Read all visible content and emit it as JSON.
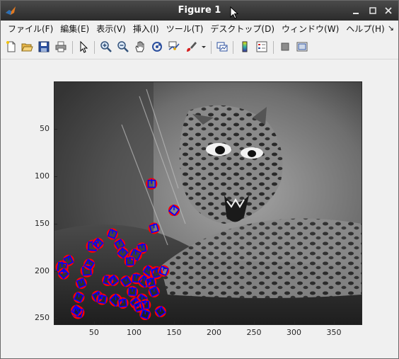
{
  "window": {
    "title": "Figure 1"
  },
  "menu": [
    "ファイル(F)",
    "編集(E)",
    "表示(V)",
    "挿入(I)",
    "ツール(T)",
    "デスクトップ(D)",
    "ウィンドウ(W)",
    "ヘルプ(H)"
  ],
  "menu_overflow": "↘",
  "toolbar_icons": [
    "new-figure-icon",
    "open-file-icon",
    "save-icon",
    "print-icon",
    "pointer-arrow-icon",
    "zoom-in-icon",
    "zoom-out-icon",
    "pan-hand-icon",
    "rotate-3d-icon",
    "data-cursor-icon",
    "brush-icon",
    "dropdown-arrow-icon",
    "link-plot-icon",
    "colorbar-icon",
    "legend-icon",
    "hide-plot-tools-icon",
    "show-plot-tools-icon"
  ],
  "image_description_free": "",
  "axes": {
    "x_ticks": [
      "50",
      "100",
      "150",
      "200",
      "250",
      "300",
      "350"
    ],
    "y_ticks": [
      "50",
      "100",
      "150",
      "200",
      "250"
    ]
  },
  "chart_data": {
    "type": "scatter",
    "title": "",
    "xlabel": "",
    "ylabel": "",
    "xlim": [
      0.5,
      384.5
    ],
    "ylim": [
      256.5,
      0.5
    ],
    "y_reversed": true,
    "series": [
      {
        "marker": "circle",
        "colors": {
          "circle": "#ff0000",
          "line": "#0000ff"
        },
        "x": [
          122,
          150,
          125,
          73,
          82,
          48,
          55,
          110,
          102,
          18,
          10,
          12,
          41,
          44,
          34,
          67,
          74,
          95,
          118,
          128,
          137,
          90,
          103,
          113,
          121,
          31,
          54,
          60,
          77,
          86,
          110,
          125,
          30,
          102,
          114,
          28,
          106,
          114,
          133,
          98,
          86
        ],
        "y": [
          108,
          136,
          155,
          161,
          172,
          174,
          171,
          176,
          183,
          189,
          196,
          203,
          200,
          193,
          213,
          210,
          210,
          190,
          200,
          202,
          200,
          211,
          208,
          211,
          212,
          228,
          227,
          230,
          231,
          234,
          230,
          222,
          244,
          234,
          236,
          242,
          238,
          246,
          243,
          222,
          181
        ],
        "r": [
          6,
          6,
          6,
          6,
          6,
          7,
          6,
          6,
          7,
          6,
          7,
          6,
          7,
          6,
          6,
          6,
          6,
          6,
          6,
          7,
          6,
          6,
          6,
          7,
          6,
          6,
          6,
          6,
          7,
          6,
          6,
          6,
          7,
          6,
          6,
          6,
          6,
          6,
          6,
          6,
          6
        ]
      }
    ]
  }
}
